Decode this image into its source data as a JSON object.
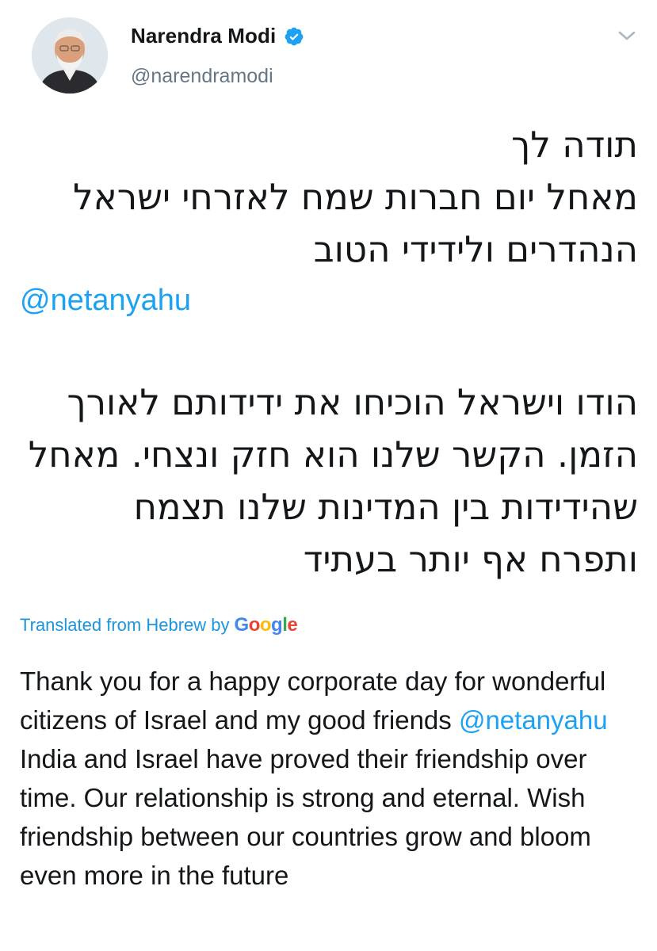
{
  "author": {
    "name": "Narendra Modi",
    "handle": "@narendramodi",
    "verified": true,
    "avatar_icon": "avatar-photo"
  },
  "tweet": {
    "hebrew_lines_1": [
      "תודה לך",
      "מאחל יום חברות  שמח לאזרחי ישראל",
      "הנהדרים ולידידי הטוב"
    ],
    "mention": "@netanyahu",
    "hebrew_lines_2": [
      "הודו וישראל הוכיחו את ידידותם לאורך",
      "הזמן. הקשר שלנו הוא חזק ונצחי. מאחל",
      "שהידידות בין המדינות שלנו תצמח",
      "ותפרח אף יותר בעתיד"
    ]
  },
  "translation": {
    "label": "Translated from Hebrew by",
    "provider": "Google",
    "text_before": "Thank you for a happy corporate day for wonderful citizens of Israel and my good friends ",
    "mention": "@netanyahu",
    "text_after": " India and Israel have proved their friendship over time. Our relationship is strong and eternal. Wish friendship between our countries grow and bloom even more in the future"
  },
  "colors": {
    "link": "#1da1f2",
    "handle": "#657786",
    "text": "#14171a"
  }
}
